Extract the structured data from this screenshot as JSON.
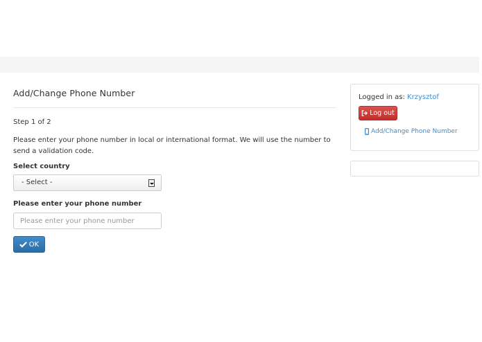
{
  "header": {},
  "main": {
    "title": "Add/Change Phone Number",
    "step": "Step 1 of 2",
    "intro": "Please enter your phone number in local or international format. We will use the number to send a validation code.",
    "country_label": "Select country",
    "country_selected": "- Select -",
    "phone_label": "Please enter your phone number",
    "phone_placeholder": "Please enter your phone number",
    "phone_value": "",
    "ok_label": "OK"
  },
  "sidebar": {
    "logged_in_prefix": "Logged in as:",
    "username": "Krzysztof",
    "logout_label": "Log out",
    "nav_link_label": "Add/Change Phone Number"
  },
  "colors": {
    "primary": "#428bca",
    "danger": "#d9534f",
    "bar_background": "#f5f5f5"
  },
  "icons": {
    "ok": "check-icon",
    "logout": "logout-icon",
    "nav": "mobile-phone-icon",
    "select": "dropdown-arrow-icon"
  }
}
